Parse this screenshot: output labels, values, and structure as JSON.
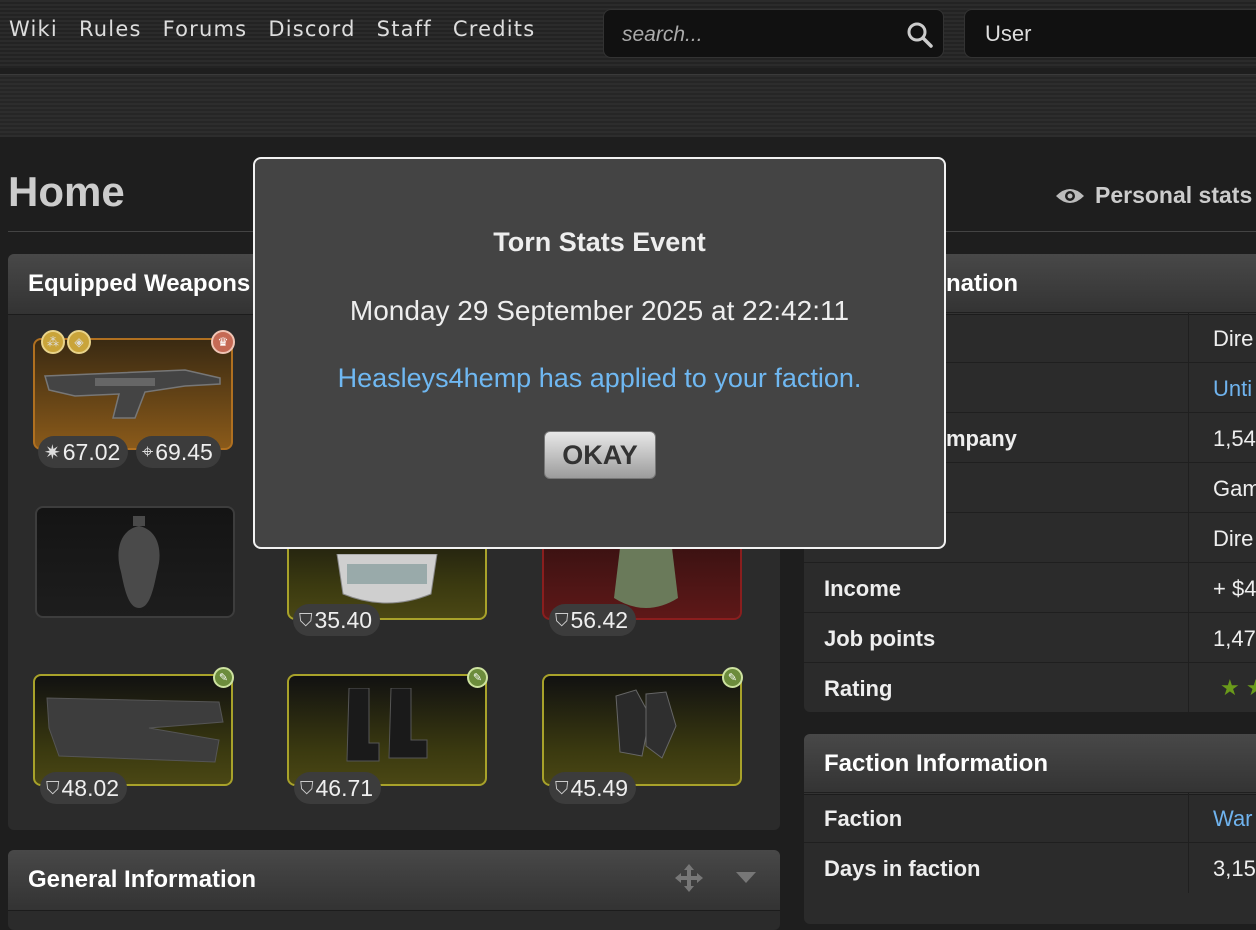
{
  "nav": {
    "items": [
      "Wiki",
      "Rules",
      "Forums",
      "Discord",
      "Staff",
      "Credits"
    ]
  },
  "search": {
    "placeholder": "search..."
  },
  "user_field": {
    "label": "User"
  },
  "page": {
    "title": "Home",
    "personal_stats": "Personal stats"
  },
  "equipped": {
    "title": "Equipped Weapons",
    "primary_stats": {
      "damage": "67.02",
      "accuracy": "69.45"
    },
    "armor_values": [
      "35.40",
      "56.42",
      "48.02",
      "46.71",
      "45.49"
    ]
  },
  "job_info": {
    "title_partial": "nation",
    "rows": [
      {
        "key": "",
        "value": "Dire"
      },
      {
        "key": "",
        "value": "Unti",
        "link": true
      },
      {
        "key": "mpany",
        "value": "1,54"
      },
      {
        "key": "",
        "value": "Gam"
      },
      {
        "key": "",
        "value": "Dire"
      },
      {
        "key": "Income",
        "value": "+ $4"
      },
      {
        "key": "Job points",
        "value": "1,47"
      },
      {
        "key": "Rating",
        "value": ""
      }
    ]
  },
  "faction_info": {
    "title": "Faction Information",
    "rows": [
      {
        "key": "Faction",
        "value": "War",
        "link": true
      },
      {
        "key": "Days in faction",
        "value": "3,15"
      }
    ]
  },
  "general_info": {
    "title": "General Information"
  },
  "modal": {
    "title": "Torn Stats Event",
    "date": "Monday 29 September 2025 at 22:42:11",
    "message": "Heasleys4hemp has applied to your faction.",
    "ok_label": "OKAY"
  },
  "colors": {
    "link": "#6fb3ee",
    "rating_star": "#6a9a1a",
    "modal_border": "#f2f2f2"
  },
  "icons": [
    "search-icon",
    "eye-icon",
    "move-icon",
    "chevron-down-icon",
    "star-icon",
    "shield-icon",
    "damage-icon",
    "accuracy-icon",
    "grenade-icon"
  ]
}
